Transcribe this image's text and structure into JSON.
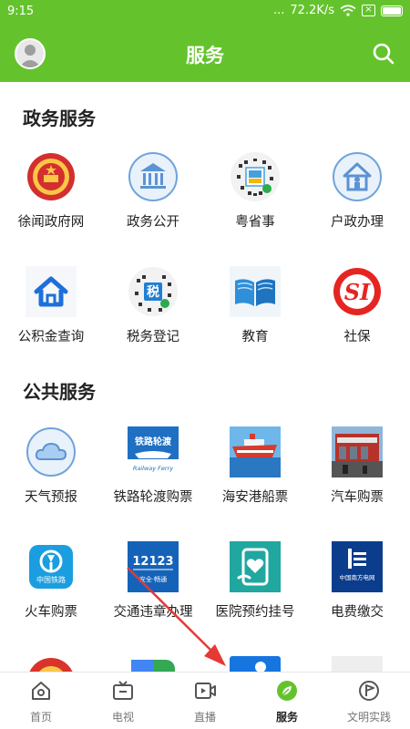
{
  "status_bar": {
    "time": "9:15",
    "speed": "72.2K/s",
    "signal_dots": "...",
    "box_icon": "×"
  },
  "header": {
    "title": "服务"
  },
  "sections": [
    {
      "title": "政务服务",
      "items": [
        "徐闻政府网",
        "政务公开",
        "粤省事",
        "户政办理",
        "公积金查询",
        "税务登记",
        "教育",
        "社保"
      ]
    },
    {
      "title": "公共服务",
      "items": [
        "天气预报",
        "铁路轮渡购票",
        "海安港船票",
        "汽车购票",
        "火车购票",
        "交通违章办理",
        "医院预约挂号",
        "电费缴交"
      ]
    }
  ],
  "badges": {
    "rail_ferry_text": "铁路轮渡",
    "rail_ferry_sub": "Railway Ferry",
    "traffic_number": "12123",
    "traffic_sub": "安全·畅通",
    "china_railway": "中国铁路",
    "grid_company": "中国南方电网",
    "shebao": "SI",
    "tax_char": "税"
  },
  "bottom_nav": [
    {
      "label": "首页",
      "icon": "home-icon"
    },
    {
      "label": "电视",
      "icon": "tv-icon"
    },
    {
      "label": "直播",
      "icon": "live-video-icon"
    },
    {
      "label": "服务",
      "icon": "service-leaf-icon",
      "active": true
    },
    {
      "label": "文明实践",
      "icon": "practice-flag-icon"
    }
  ],
  "colors": {
    "primary": "#64c32d",
    "arrow": "#e53935"
  }
}
